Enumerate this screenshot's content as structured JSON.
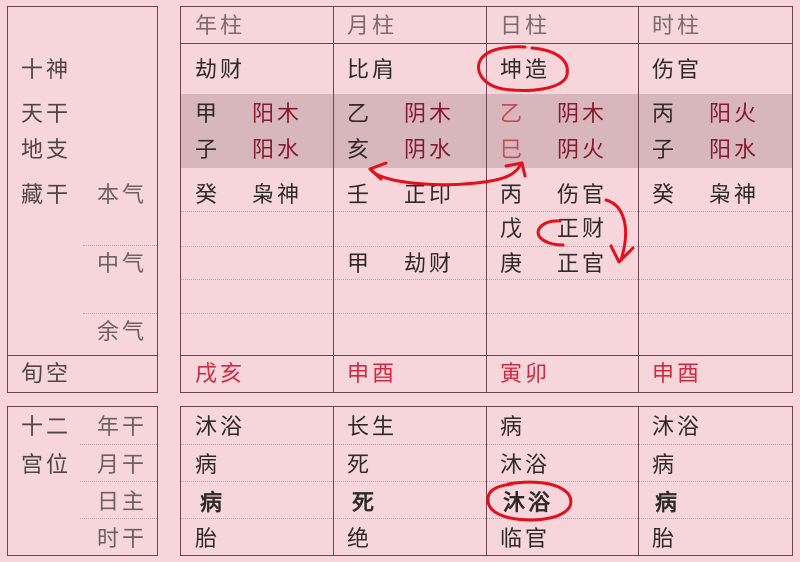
{
  "colors": {
    "background": "#f6d6da",
    "band": "#d8b7bc",
    "border": "#6f4552",
    "element_red": "#861a2c",
    "day_stem_red": "#c44a5c",
    "void_red": "#d02a3f",
    "annotation_red": "#e3101c"
  },
  "top_table": {
    "row_labels": {
      "ten_gods": "十神",
      "heavenly_stem": "天干",
      "earthly_branch": "地支",
      "hidden_stems": "藏干",
      "main_qi": "本气",
      "middle_qi": "中气",
      "residual_qi": "余气",
      "void": "旬空"
    },
    "pillars": [
      {
        "header": "年柱",
        "ten_god": "劫财",
        "stem": "甲",
        "stem_element": "阳木",
        "branch": "子",
        "branch_element": "阳水",
        "hidden": [
          {
            "stem": "癸",
            "god": "枭神"
          },
          {
            "stem": "",
            "god": ""
          },
          {
            "stem": "",
            "god": ""
          },
          {
            "stem": "",
            "god": ""
          },
          {
            "stem": "",
            "god": ""
          }
        ],
        "void": "戌亥"
      },
      {
        "header": "月柱",
        "ten_god": "比肩",
        "stem": "乙",
        "stem_element": "阴木",
        "branch": "亥",
        "branch_element": "阴水",
        "hidden": [
          {
            "stem": "壬",
            "god": "正印"
          },
          {
            "stem": "",
            "god": ""
          },
          {
            "stem": "甲",
            "god": "劫财"
          },
          {
            "stem": "",
            "god": ""
          },
          {
            "stem": "",
            "god": ""
          }
        ],
        "void": "申酉"
      },
      {
        "header": "日柱",
        "ten_god": "坤造",
        "stem": "乙",
        "stem_element": "阴木",
        "branch": "巳",
        "branch_element": "阴火",
        "hidden": [
          {
            "stem": "丙",
            "god": "伤官"
          },
          {
            "stem": "戊",
            "god": "正财"
          },
          {
            "stem": "庚",
            "god": "正官"
          },
          {
            "stem": "",
            "god": ""
          },
          {
            "stem": "",
            "god": ""
          }
        ],
        "void": "寅卯"
      },
      {
        "header": "时柱",
        "ten_god": "伤官",
        "stem": "丙",
        "stem_element": "阳火",
        "branch": "子",
        "branch_element": "阳水",
        "hidden": [
          {
            "stem": "癸",
            "god": "枭神"
          },
          {
            "stem": "",
            "god": ""
          },
          {
            "stem": "",
            "god": ""
          },
          {
            "stem": "",
            "god": ""
          },
          {
            "stem": "",
            "god": ""
          }
        ],
        "void": "申酉"
      }
    ]
  },
  "bottom_table": {
    "title_line1": "十二",
    "title_line2": "宫位",
    "row_labels": [
      "年干",
      "月干",
      "日主",
      "时干"
    ],
    "columns": [
      [
        "沐浴",
        "病",
        "病",
        "胎"
      ],
      [
        "长生",
        "死",
        "死",
        "绝"
      ],
      [
        "病",
        "沐浴",
        "沐浴",
        "临官"
      ],
      [
        "沐浴",
        "病",
        "病",
        "胎"
      ]
    ]
  }
}
